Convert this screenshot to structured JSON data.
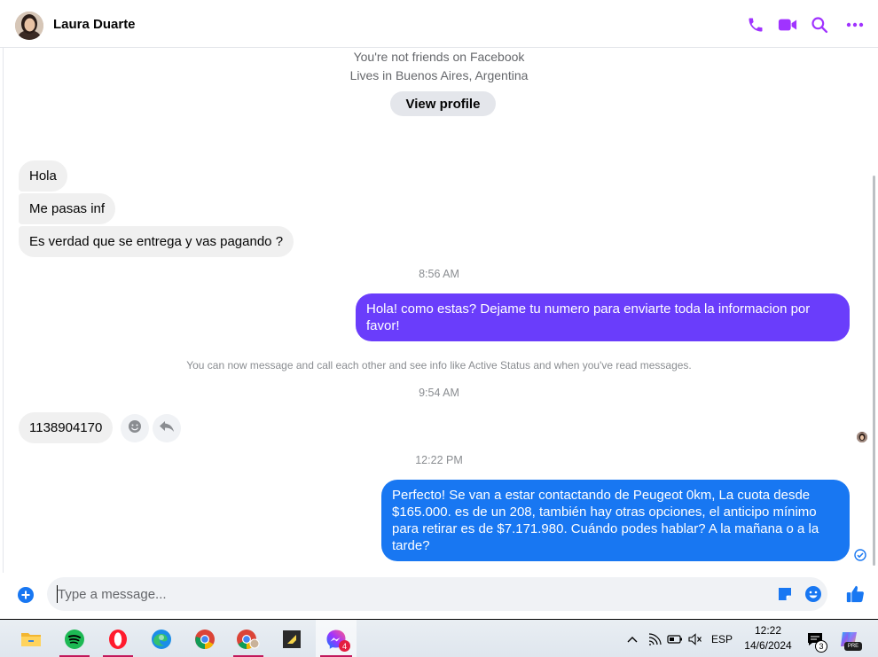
{
  "header": {
    "contact_name": "Laura Duarte",
    "accent": "#a033ff"
  },
  "intro": {
    "not_friends": "You're not friends on Facebook",
    "lives_in": "Lives in Buenos Aires, Argentina",
    "view_profile": "View profile"
  },
  "messages": {
    "in_1": "Hola",
    "in_2": "Me pasas inf",
    "in_3": "Es verdad que se entrega y vas pagando ?",
    "ts_1": "8:56 AM",
    "out_1": "Hola! como estas? Dejame tu numero para enviarte toda la informacion por favor!",
    "system_note": "You can now message and call each other and see info like Active Status and when you've read messages.",
    "ts_2": "9:54 AM",
    "in_4": "1138904170",
    "ts_3": "12:22 PM",
    "out_2": "Perfecto!  Se van a estar contactando de Peugeot 0km, La cuota desde $165.000. es de un 208, también hay otras opciones, el anticipo mínimo para retirar es de $7.171.980. Cuándo podes hablar? A la mañana o a la tarde?"
  },
  "colors": {
    "out_bubble_1": "#6a3dfb",
    "out_bubble_2": "#1877f2",
    "in_bubble": "#f0f0f0"
  },
  "composer": {
    "placeholder": "Type a message..."
  },
  "taskbar": {
    "language": "ESP",
    "time": "12:22",
    "date": "14/6/2024",
    "messenger_badge": "4",
    "notifications_badge": "3",
    "copilot_badge": "PRE"
  }
}
